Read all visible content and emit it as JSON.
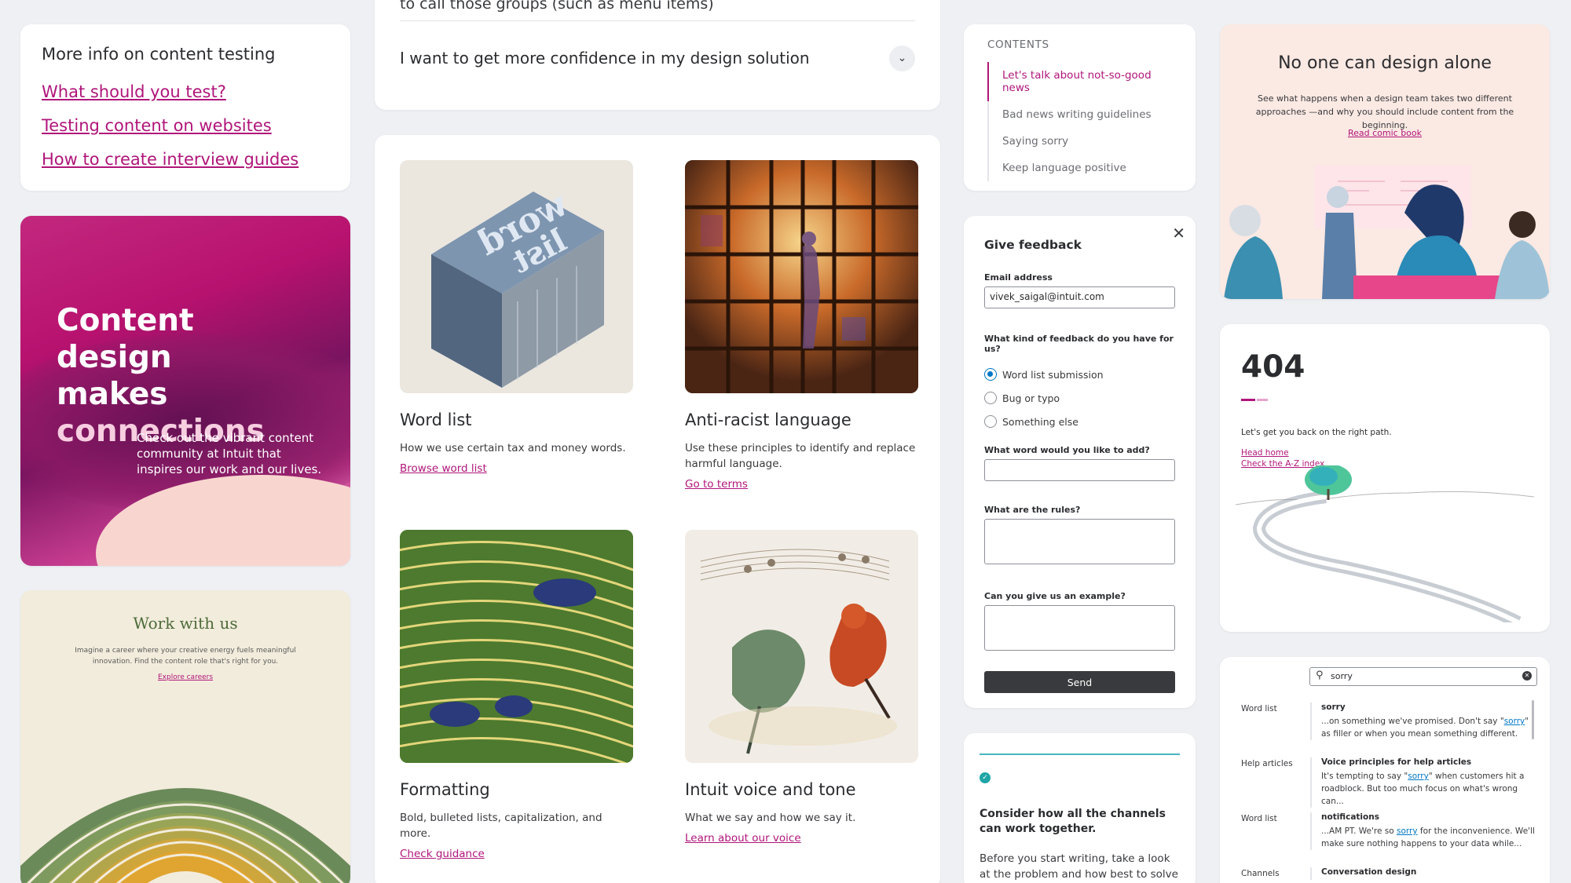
{
  "more_info": {
    "title": "More info on content testing",
    "links": [
      "What should you test?",
      "Testing content on websites",
      "How to create interview guides"
    ]
  },
  "hero": {
    "line1": "Content design",
    "line2": "makes",
    "line3": "connections",
    "body": "Check out the vibrant content community at Intuit that inspires our work and our lives."
  },
  "work": {
    "title": "Work with us",
    "body": "Imagine a career where your creative energy fuels meaningful innovation. Find the content role that's right for you.",
    "link": "Explore careers"
  },
  "accordion": {
    "cut_text": "to call those groups (such as menu items)",
    "question": "I want to get more confidence in my design solution",
    "chevron_icon": "chevron-down-icon"
  },
  "tiles": [
    {
      "title": "Word list",
      "desc": "How we use certain tax and money words.",
      "link": "Browse word list"
    },
    {
      "title": "Anti-racist language",
      "desc": "Use these principles to identify and replace harmful language.",
      "link": "Go to terms"
    },
    {
      "title": "Formatting",
      "desc": "Bold, bulleted lists, capitalization, and more.",
      "link": "Check guidance"
    },
    {
      "title": "Intuit voice and tone",
      "desc": "What we say and how we say it.",
      "link": "Learn about our voice"
    }
  ],
  "contents": {
    "heading": "CONTENTS",
    "items": [
      "Let's talk about not-so-good news",
      "Bad news writing guidelines",
      "Saying sorry",
      "Keep language positive"
    ]
  },
  "feedback": {
    "title": "Give feedback",
    "email_label": "Email address",
    "email_value": "vivek_saigal@intuit.com",
    "kind_label": "What kind of feedback do you have for us?",
    "options": [
      "Word list submission",
      "Bug or typo",
      "Something else"
    ],
    "selected": "Word list submission",
    "word_label": "What word would you like to add?",
    "rules_label": "What are the rules?",
    "example_label": "Can you give us an example?",
    "send": "Send"
  },
  "channels": {
    "title": "Consider how all the channels can work together.",
    "body": "Before you start writing, take a look at the problem and how best to solve it"
  },
  "comic": {
    "title": "No one can design alone",
    "body": "See what happens when a design team takes two different approaches —and why you should include content from the beginning.",
    "link": "Read comic book"
  },
  "notfound": {
    "code": "404",
    "message": "Let's get you back on the right path.",
    "links": [
      "Head home",
      "Check the A-Z index"
    ]
  },
  "search": {
    "query": "sorry",
    "results": [
      {
        "category": "Word list",
        "title": "sorry",
        "pre": "...on something we've promised. Don't say \"",
        "hit": "sorry",
        "post": "\" as filler or when you mean something different."
      },
      {
        "category": "Help articles",
        "title": "Voice principles for help articles",
        "pre": "It's tempting to say \"",
        "hit": "sorry",
        "post": "\" when customers hit a roadblock. But too much focus on what's wrong can..."
      },
      {
        "category": "Word list",
        "title": "notifications",
        "pre": "...AM PT. We're so ",
        "hit": "sorry",
        "post": " for the inconvenience. We'll make sure nothing happens to your data while..."
      },
      {
        "category": "Channels",
        "title": "Conversation design",
        "pre": "",
        "hit": "",
        "post": ""
      }
    ]
  },
  "colors": {
    "accent": "#b0157a",
    "link_blue": "#0077c5",
    "teal": "#1fa5a5",
    "dark_button": "#393a3d"
  }
}
